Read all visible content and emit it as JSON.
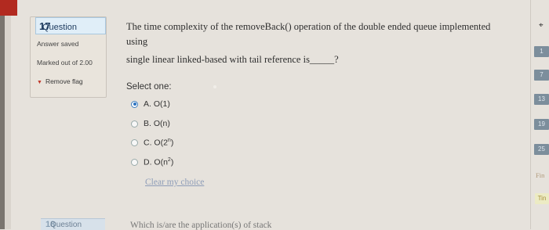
{
  "question": {
    "number_prefix": "Question",
    "number": "17",
    "status": "Answer saved",
    "marks": "Marked out of 2.00",
    "flag_label": "Remove flag",
    "text_line1": "The time complexity of the removeBack() operation of the double ended queue implemented",
    "text_line2": "using",
    "text_line3": "single linear linked-based with tail reference is_____?",
    "select_one": "Select one:",
    "options": [
      {
        "label": "A. O(1)",
        "selected": true
      },
      {
        "label": "B. O(n)",
        "selected": false
      },
      {
        "label": "C. O(2",
        "sup": "n",
        "tail": ")",
        "selected": false
      },
      {
        "label": "D. O(n",
        "sup": "2",
        "tail": ")",
        "selected": false
      }
    ],
    "clear_choice": "Clear my choice"
  },
  "next_question": {
    "prefix": "Question",
    "number": "18",
    "text": "Which is/are the application(s) of stack"
  },
  "right_nav": {
    "pin": "⌖",
    "items": [
      "1",
      "7",
      "13",
      "19",
      "25"
    ],
    "finish": "Fin",
    "time": "Tin"
  },
  "colors": {
    "accent": "#2f74c0",
    "question_header_bg": "#e0eef8",
    "link": "#8e9db8"
  }
}
